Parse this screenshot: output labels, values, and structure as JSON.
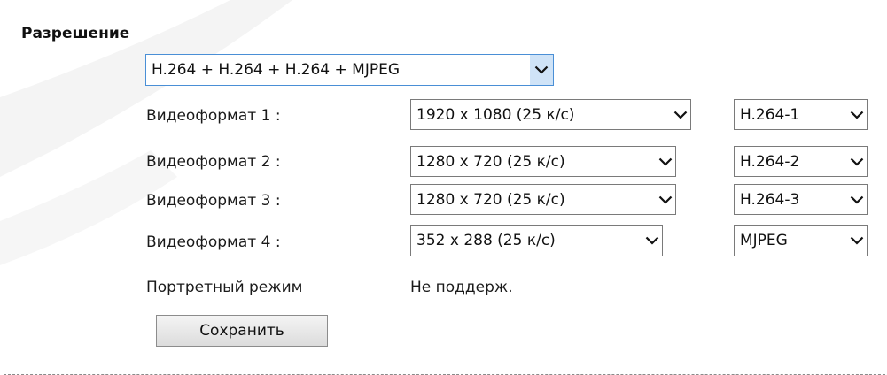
{
  "section": {
    "title": "Разрешение"
  },
  "mode_select": {
    "value": "H.264 + H.264 + H.264 + MJPEG"
  },
  "video_formats": [
    {
      "label": "Видеоформат 1 :",
      "resolution": "1920 x 1080 (25 к/с)",
      "codec": "H.264-1"
    },
    {
      "label": "Видеоформат 2 :",
      "resolution": "1280 x 720 (25 к/с)",
      "codec": "H.264-2"
    },
    {
      "label": "Видеоформат 3 :",
      "resolution": "1280 x 720 (25 к/с)",
      "codec": "H.264-3"
    },
    {
      "label": "Видеоформат 4 :",
      "resolution": "352 x 288 (25 к/с)",
      "codec": "MJPEG"
    }
  ],
  "portrait": {
    "label": "Портретный режим",
    "value": "Не поддерж."
  },
  "save_button": {
    "label": "Сохранить"
  },
  "colors": {
    "focus_border": "#4a8fd6",
    "focus_chevron_bg": "#cfe3f7",
    "watermark": "#f3f3f3"
  },
  "icons": {
    "dropdown": "chevron-down-icon"
  }
}
